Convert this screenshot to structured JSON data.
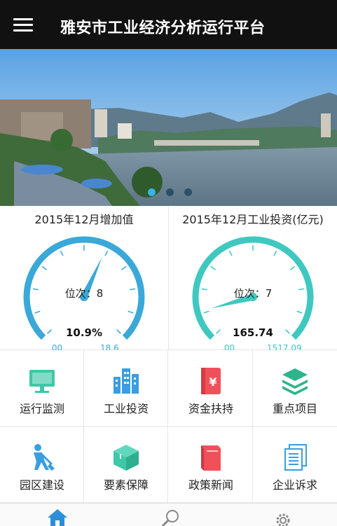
{
  "header": {
    "title": "雅安市工业经济分析运行平台",
    "menu_icon": "hamburger-menu-icon"
  },
  "banner": {
    "image": "river-city-landscape",
    "slide_count": 3,
    "active_slide": 1
  },
  "stats": [
    {
      "title": "2015年12月增加值",
      "rank_label": "位次：8",
      "value": "10.9%",
      "min": ".00",
      "max": "18.6",
      "fraction": 0.59,
      "color": "#3aa8d8"
    },
    {
      "title": "2015年12月工业投资(亿元)",
      "rank_label": "位次：7",
      "value": "165.74",
      "min": ".00",
      "max": "1517.09",
      "fraction": 0.11,
      "color": "#3ec8c0"
    }
  ],
  "grid": [
    {
      "label": "运行监测",
      "icon": "monitor-icon",
      "color": "#3ec8a8"
    },
    {
      "label": "工业投资",
      "icon": "buildings-icon",
      "color": "#3a9ee0"
    },
    {
      "label": "资金扶持",
      "icon": "money-book-icon",
      "color": "#f0505a"
    },
    {
      "label": "重点项目",
      "icon": "layers-icon",
      "color": "#2cb58a"
    },
    {
      "label": "园区建设",
      "icon": "worker-shovel-icon",
      "color": "#3a9ee0"
    },
    {
      "label": "要素保障",
      "icon": "box-icon",
      "color": "#3ec8a8"
    },
    {
      "label": "政策新闻",
      "icon": "book-icon",
      "color": "#f0505a"
    },
    {
      "label": "企业诉求",
      "icon": "documents-icon",
      "color": "#3a9ee0"
    }
  ],
  "bottom_nav": [
    {
      "icon": "home-icon",
      "active": true,
      "color": "#2a8fd8"
    },
    {
      "icon": "search-icon",
      "active": false,
      "color": "#888888"
    },
    {
      "icon": "settings-icon",
      "active": false,
      "color": "#888888"
    }
  ]
}
